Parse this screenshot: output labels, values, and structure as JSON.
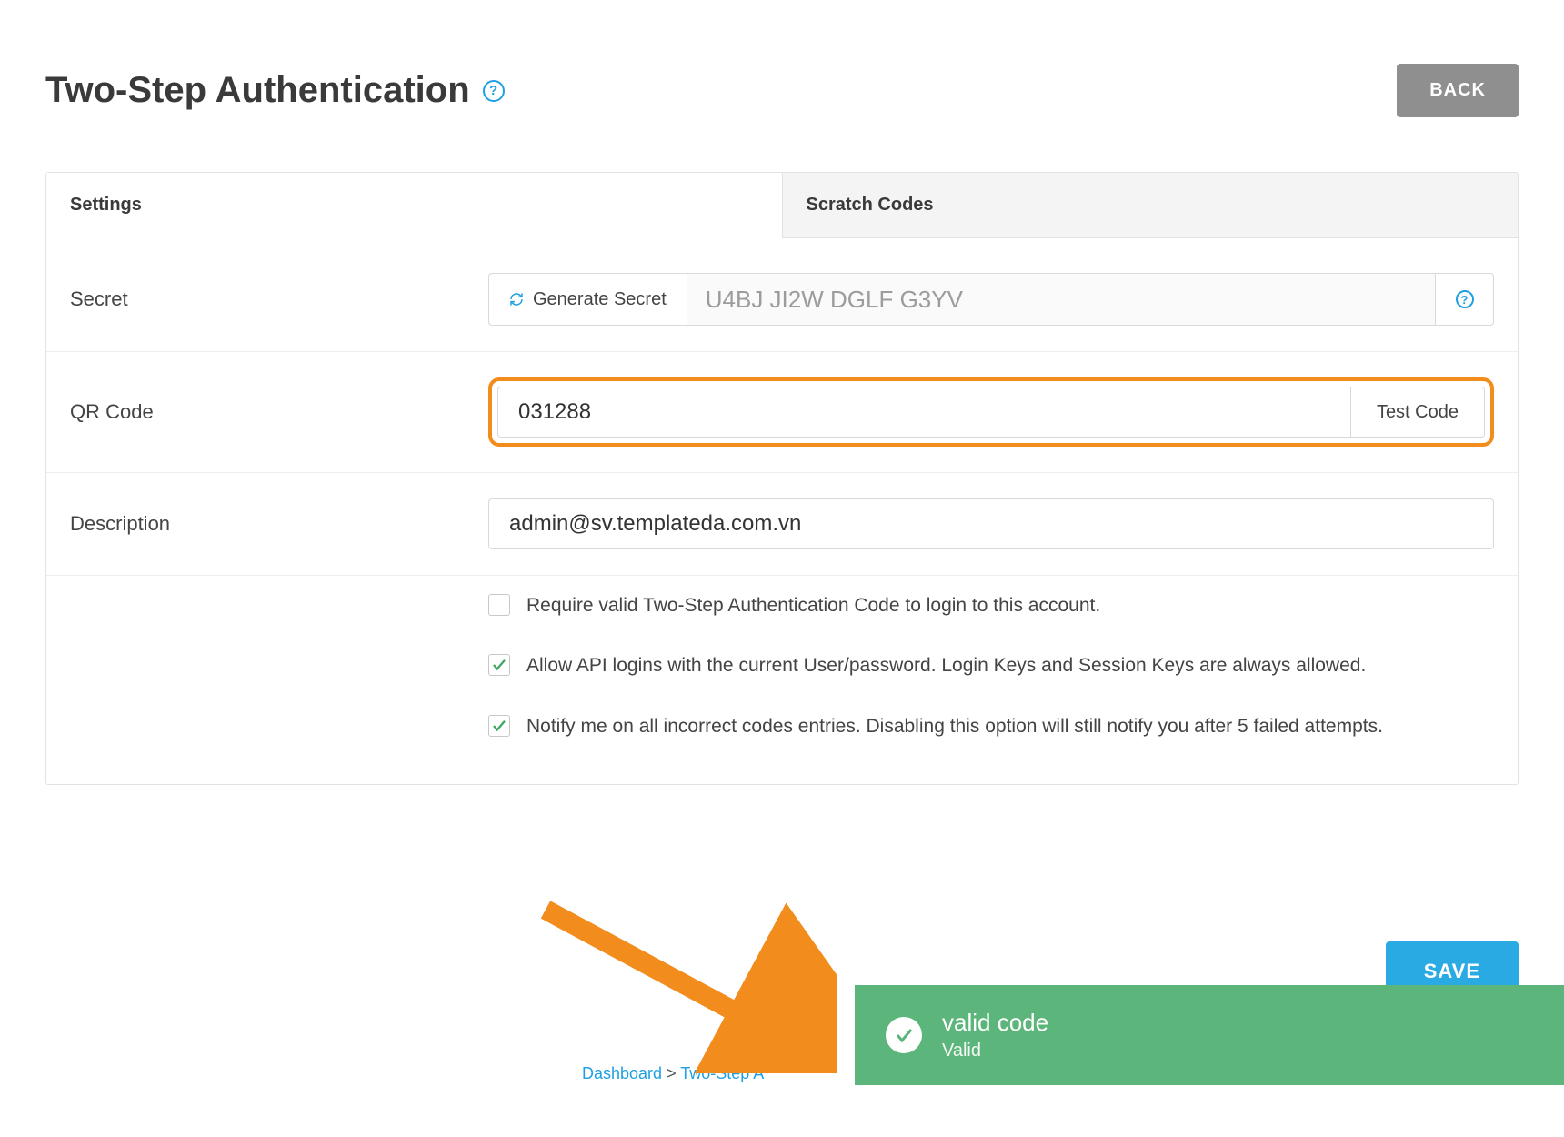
{
  "header": {
    "title": "Two-Step Authentication",
    "back_label": "BACK"
  },
  "tabs": {
    "settings": "Settings",
    "scratch": "Scratch Codes"
  },
  "fields": {
    "secret_label": "Secret",
    "generate_secret_label": "Generate Secret",
    "secret_value": "U4BJ JI2W DGLF G3YV",
    "qr_label": "QR Code",
    "qr_value": "031288",
    "test_code_label": "Test Code",
    "desc_label": "Description",
    "desc_value": "admin@sv.templateda.com.vn"
  },
  "checks": {
    "require": "Require valid Two-Step Authentication Code to login to this account.",
    "api": "Allow API logins with the current User/password. Login Keys and Session Keys are always allowed.",
    "notify": "Notify me on all incorrect codes entries. Disabling this option will still notify you after 5 failed attempts."
  },
  "save_label": "SAVE",
  "breadcrumb": {
    "dashboard": "Dashboard",
    "sep": " > ",
    "current": "Two-Step A"
  },
  "toast": {
    "title": "valid code",
    "sub": "Valid"
  }
}
